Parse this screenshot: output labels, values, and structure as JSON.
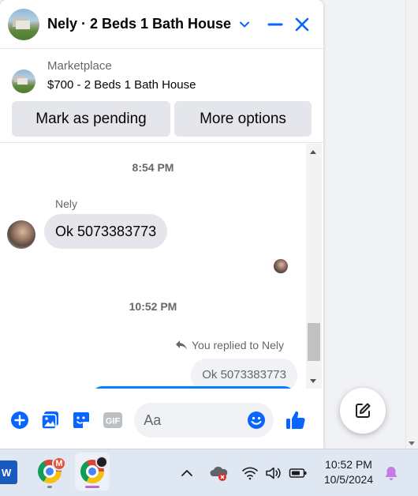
{
  "chat": {
    "header": {
      "title": "Nely · 2 Beds 1 Bath House"
    },
    "listing": {
      "category": "Marketplace",
      "price_title": "$700 - 2 Beds 1 Bath House"
    },
    "actions": {
      "mark_pending": "Mark as pending",
      "more_options": "More options"
    },
    "messages": {
      "timestamp1": "8:54 PM",
      "sender_name": "Nely",
      "incoming_text": "Ok 5073383773",
      "timestamp2": "10:52 PM",
      "reply_note": "You replied to Nely",
      "quoted_text": "Ok 5073383773"
    },
    "composer": {
      "placeholder": "Aa"
    }
  },
  "taskbar": {
    "word_letter": "W",
    "mail_badge": "M",
    "time": "10:52 PM",
    "date": "10/5/2024"
  },
  "colors": {
    "messenger_blue": "#0a7cff",
    "icon_blue": "#0866ff",
    "bubble_gray": "#e4e6eb"
  },
  "icons": [
    "chevron-down-icon",
    "minimize-icon",
    "close-icon",
    "reply-icon",
    "add-icon",
    "image-icon",
    "sticker-icon",
    "gif-icon",
    "emoji-icon",
    "like-icon",
    "compose-icon",
    "chevron-up-icon",
    "cloud-icon",
    "wifi-icon",
    "volume-icon",
    "battery-icon",
    "bell-icon"
  ]
}
